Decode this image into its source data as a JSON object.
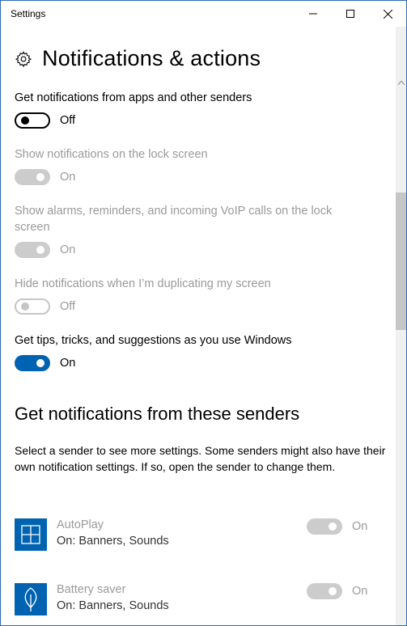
{
  "window": {
    "title": "Settings",
    "controls": {
      "minimize_icon": "minimize-icon",
      "maximize_icon": "maximize-icon",
      "close_icon": "close-icon"
    }
  },
  "page": {
    "icon": "gear-icon",
    "title": "Notifications & actions"
  },
  "settings": [
    {
      "label": "Get notifications from apps and other senders",
      "state": "Off",
      "enabled": true
    },
    {
      "label": "Show notifications on the lock screen",
      "state": "On",
      "enabled": false
    },
    {
      "label": "Show alarms, reminders, and incoming VoIP calls on the lock screen",
      "state": "On",
      "enabled": false
    },
    {
      "label": "Hide notifications when I’m duplicating my screen",
      "state": "Off",
      "enabled": false
    },
    {
      "label": "Get tips, tricks, and suggestions as you use Windows",
      "state": "On",
      "enabled": true
    }
  ],
  "senders_section": {
    "title": "Get notifications from these senders",
    "description": "Select a sender to see more settings. Some senders might also have their own notification settings. If so, open the sender to change them.",
    "senders": [
      {
        "name": "AutoPlay",
        "detail": "On: Banners, Sounds",
        "state": "On",
        "icon": "autoplay-icon"
      },
      {
        "name": "Battery saver",
        "detail": "On: Banners, Sounds",
        "state": "On",
        "icon": "battery-saver-icon"
      }
    ]
  },
  "colors": {
    "accent": "#0063b1",
    "disabled_text": "#9a9a9a",
    "disabled_toggle": "#cccccc"
  }
}
